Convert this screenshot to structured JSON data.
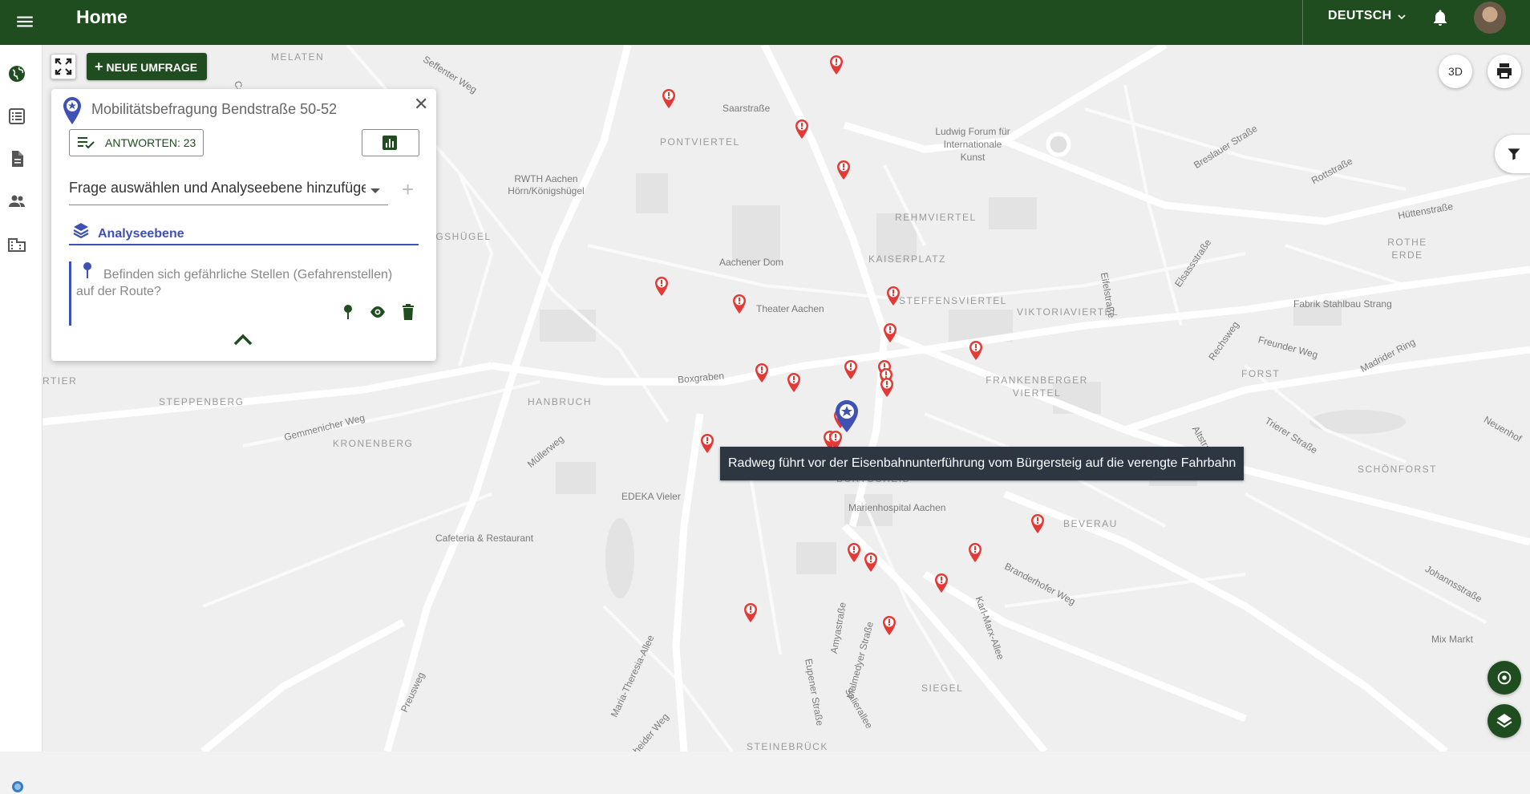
{
  "header": {
    "title": "Home",
    "language": "DEUTSCH"
  },
  "toolbar": {
    "new_survey_label": "NEUE UMFRAGE"
  },
  "survey_panel": {
    "title": "Mobilitätsbefragung Bendstraße 50-52",
    "answers_label": "ANTWORTEN: 23",
    "question_select_value": "Frage auswählen und Analyseebene hinzufügen",
    "analysis_layer_label": "Analyseebene",
    "question_text": "Befinden sich gefährliche Stellen (Gefahrenstellen) auf der Route?"
  },
  "map": {
    "tooltip": "Radweg führt vor der Eisenbahnunterführung vom Bürgersteig auf die verengte Fahrbahn",
    "view_3d_label": "3D",
    "labels": {
      "melaten": "MELATEN",
      "seffenter_weg": "Seffenter Weg",
      "saarstrasse": "Saarstraße",
      "pontviertel": "PONTVIERTEL",
      "ludwig_forum": "Ludwig Forum für Internationale Kunst",
      "rwth": "RWTH Aachen Hörn/Königshügel",
      "koenigshuegel": "KÖNIGSHÜGEL",
      "rehmviertel": "REHMVIERTEL",
      "kaiserplatz": "KAISERPLATZ",
      "aachener_dom": "Aachener Dom",
      "steffensviertel": "STEFFENSVIERTEL",
      "viktoriaviertel": "VIKTORIAVIERTEL",
      "theater": "Theater Aachen",
      "boxgraben": "Boxgraben",
      "hanbruch": "HANBRUCH",
      "steppenberg": "STEPPENBERG",
      "kronenberg": "KRONENBERG",
      "frankenberger": "FRANKENBERGER VIERTEL",
      "edeka": "EDEKA Vieler",
      "cafeteria": "Cafeteria & Restaurant",
      "marienhospital": "Marienhospital Aachen",
      "burtscheid": "BURTSCHEID",
      "beverau": "BEVERAU",
      "siegel": "SIEGEL",
      "steinebrueck": "STEINEBRÜCK",
      "forst": "FORST",
      "schoenforst": "SCHÖNFORST",
      "rothe_erde": "ROTHE ERDE",
      "fabrik": "Fabrik Stahlbau Strang",
      "mix_markt": "Mix Markt",
      "breslauer": "Breslauer Straße",
      "rottstrasse": "Rottstraße",
      "huettenstrasse": "Hüttenstraße",
      "trierer": "Trierer Straße",
      "madrider_ring": "Madrider Ring",
      "freunder_weg": "Freunder Weg",
      "eupener": "Eupener Straße",
      "karl_marx": "Karl-Marx-Allee",
      "malmedyer": "Malmedyer Straße",
      "salierallee": "Salierallee",
      "ronheider": "Ronheider Weg",
      "maria_theresia": "Maria-Theresia-Allee",
      "gemmenicher": "Gemmenicher Weg",
      "preusweg": "Preusweg",
      "branderhofer": "Branderhofer Weg",
      "elsassstrasse": "Elsassstraße",
      "rechsweg": "Rechsweg",
      "eifelstrasse": "Eifelstraße",
      "altstrasse": "Altstraße",
      "neuenhof": "Neuenhof",
      "johannsstrasse": "Johannsstraße",
      "ainyastrasse": "Amyastraße",
      "campus": "Campus",
      "rtier": "RTIER",
      "muellerweg": "Müllerweg"
    }
  },
  "colors": {
    "header_bg": "#1f4d1f",
    "accent": "#3f51b5",
    "marker_red": "#e53935"
  },
  "icons": {
    "sidebar": [
      "globe-icon",
      "list-icon",
      "document-icon",
      "people-icon",
      "building-icon"
    ],
    "header": [
      "menu-icon",
      "chevron-down-icon",
      "bell-icon"
    ]
  }
}
